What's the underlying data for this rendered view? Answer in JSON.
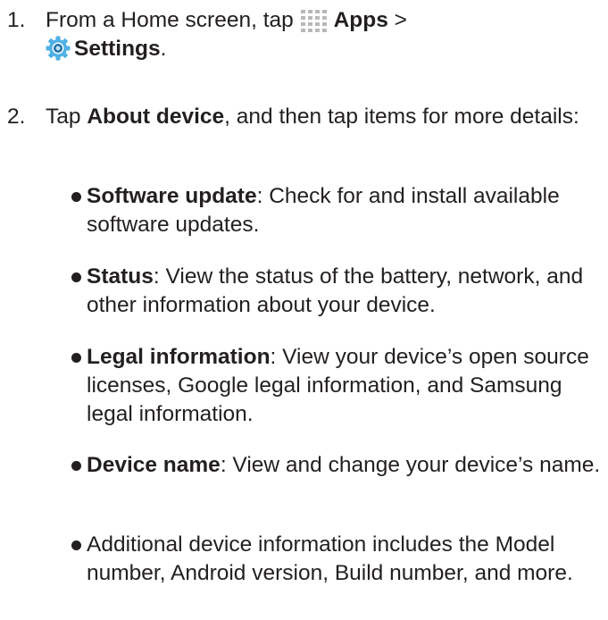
{
  "steps": [
    {
      "number": "1.",
      "prefix": "From a Home screen, tap ",
      "apps_label": "Apps",
      "separator": " >",
      "settings_label": "Settings",
      "suffix": "."
    },
    {
      "number": "2.",
      "prefix": "Tap ",
      "bold": "About device",
      "rest": ", and then tap items for more details:"
    }
  ],
  "bullets": [
    {
      "bold": "Software update",
      "text": ": Check for and install available software updates."
    },
    {
      "bold": "Status",
      "text": ": View the status of the battery, network, and other information about your device."
    },
    {
      "bold": "Legal information",
      "text": ": View your device’s open source licenses, Google legal information, and Samsung legal information."
    },
    {
      "bold": "Device name",
      "text": ": View and change your device’s name."
    },
    {
      "bold": "",
      "text": "Additional device information includes the Model number, Android version, Build number, and more."
    }
  ],
  "icons": {
    "apps": "apps-grid-icon",
    "settings": "settings-gear-icon"
  },
  "colors": {
    "text": "#231f20",
    "apps_icon": "#b9b9b9",
    "settings_icon_outer": "#4fb0e6",
    "settings_icon_inner": "#1f6fa8"
  }
}
